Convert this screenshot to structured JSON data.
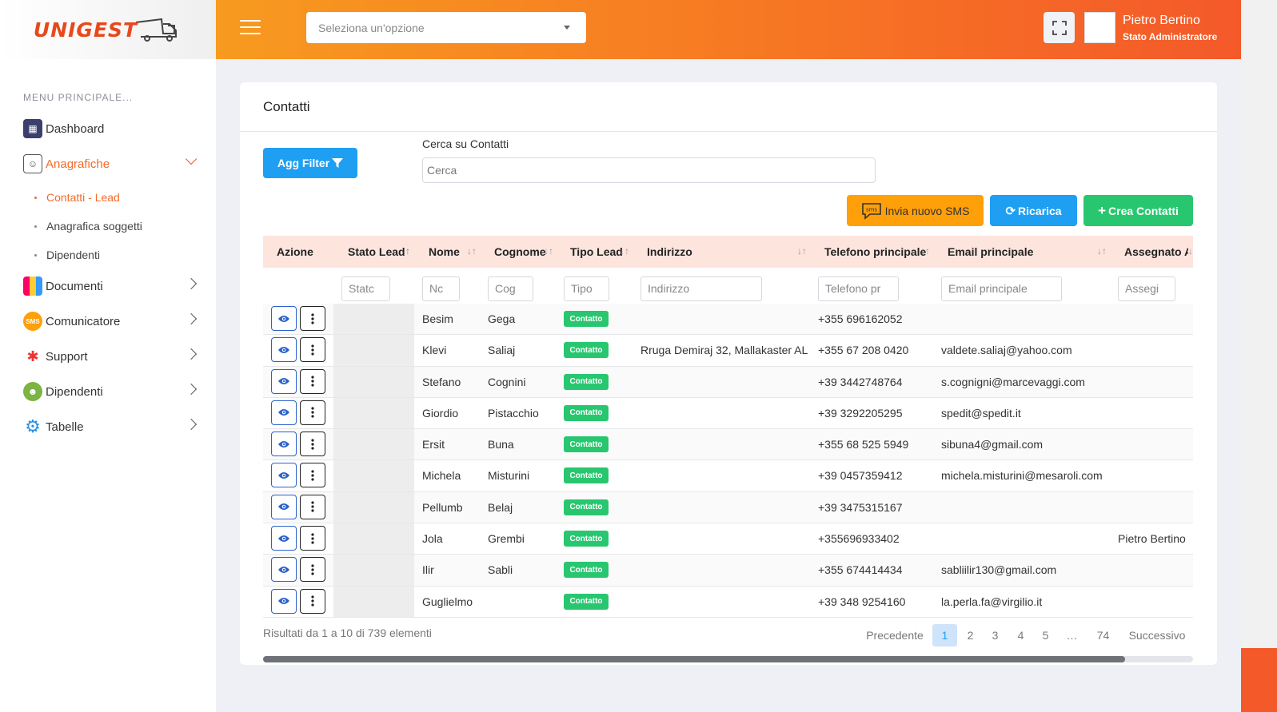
{
  "brand": {
    "logo_text": "UNIGEST",
    "accent": "#f26b2b"
  },
  "sidebar": {
    "heading": "MENU PRINCIPALE...",
    "items": [
      {
        "label": "Dashboard",
        "icon": "dashboard-icon"
      },
      {
        "label": "Anagrafiche",
        "icon": "address-book-icon",
        "expanded": true
      },
      {
        "label": "Documenti",
        "icon": "documents-icon"
      },
      {
        "label": "Comunicatore",
        "icon": "sms-icon"
      },
      {
        "label": "Support",
        "icon": "support-icon"
      },
      {
        "label": "Dipendenti",
        "icon": "employees-icon"
      },
      {
        "label": "Tabelle",
        "icon": "gear-icon"
      }
    ],
    "subitems": [
      "Contatti - Lead",
      "Anagrafica soggetti",
      "Dipendenti"
    ]
  },
  "header": {
    "select_placeholder": "Seleziona un'opzione",
    "user_name": "Pietro Bertino",
    "user_role": "Stato Administratore"
  },
  "card": {
    "title": "Contatti",
    "filter_button": "Agg Filter",
    "search_label": "Cerca su Contatti",
    "search_placeholder": "Cerca",
    "sms_button": "Invia nuovo SMS",
    "reload_button": "Ricarica",
    "create_button": "Crea Contatti"
  },
  "table": {
    "columns": [
      "Azione",
      "Stato Lead",
      "Nome",
      "Cognome",
      "Tipo Lead",
      "Indirizzo",
      "Telefono principale",
      "Email principale",
      "Assegnato A"
    ],
    "filters": [
      "Statc",
      "Nc",
      "Cog",
      "Tipo",
      "Indirizzo",
      "Telefono pr",
      "Email principale",
      "Assegi"
    ],
    "badge_label": "Contatto",
    "rows": [
      {
        "nome": "Besim",
        "cognome": "Gega",
        "indirizzo": "",
        "telefono": "+355 696162052",
        "email": "",
        "assegnato": ""
      },
      {
        "nome": "Klevi",
        "cognome": "Saliaj",
        "indirizzo": "Rruga Demiraj 32, Mallakaster AL",
        "telefono": "+355 67 208 0420",
        "email": "valdete.saliaj@yahoo.com",
        "assegnato": ""
      },
      {
        "nome": "Stefano",
        "cognome": "Cognini",
        "indirizzo": "",
        "telefono": "+39 3442748764",
        "email": "s.cognigni@marcevaggi.com",
        "assegnato": ""
      },
      {
        "nome": "Giordio",
        "cognome": "Pistacchio",
        "indirizzo": "",
        "telefono": "+39 3292205295",
        "email": "spedit@spedit.it",
        "assegnato": ""
      },
      {
        "nome": "Ersit",
        "cognome": "Buna",
        "indirizzo": "",
        "telefono": "+355 68 525 5949",
        "email": "sibuna4@gmail.com",
        "assegnato": ""
      },
      {
        "nome": "Michela",
        "cognome": "Misturini",
        "indirizzo": "",
        "telefono": "+39 0457359412",
        "email": "michela.misturini@mesaroli.com",
        "assegnato": ""
      },
      {
        "nome": "Pellumb",
        "cognome": "Belaj",
        "indirizzo": "",
        "telefono": "+39 3475315167",
        "email": "",
        "assegnato": ""
      },
      {
        "nome": "Jola",
        "cognome": "Grembi",
        "indirizzo": "",
        "telefono": "+355696933402",
        "email": "",
        "assegnato": "Pietro Bertino"
      },
      {
        "nome": "Ilir",
        "cognome": "Sabli",
        "indirizzo": "",
        "telefono": "+355 674414434",
        "email": "sabliilir130@gmail.com",
        "assegnato": ""
      },
      {
        "nome": "Guglielmo",
        "cognome": "",
        "indirizzo": "",
        "telefono": "+39 348 9254160",
        "email": "la.perla.fa@virgilio.it",
        "assegnato": ""
      }
    ]
  },
  "pagination": {
    "results": "Risultati da 1 a 10 di 739 elementi",
    "prev": "Precedente",
    "pages": [
      "1",
      "2",
      "3",
      "4",
      "5",
      "…",
      "74"
    ],
    "next": "Successivo",
    "current": "1"
  }
}
